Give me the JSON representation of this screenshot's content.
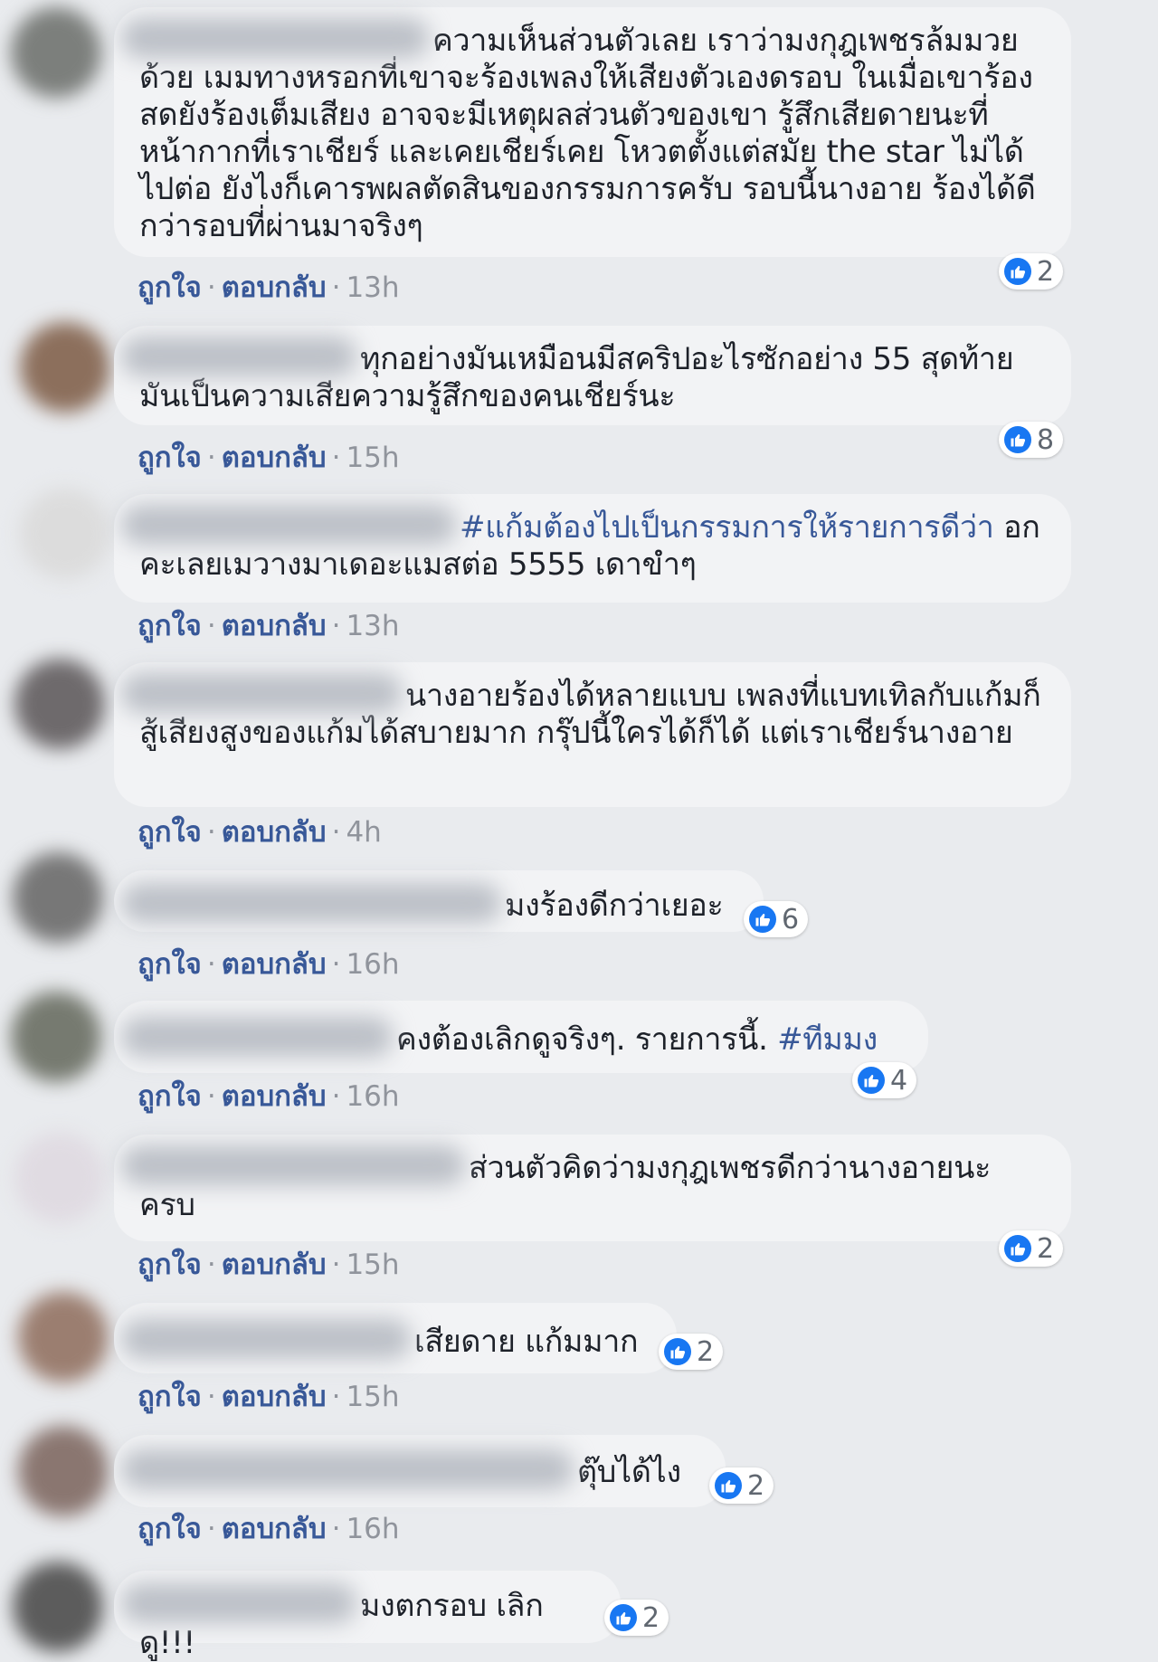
{
  "ui": {
    "like": "ถูกใจ",
    "reply": "ตอบกลับ",
    "dot": "·"
  },
  "comments": [
    {
      "text": "ความเห็นส่วนตัวเลย เราว่ามงกุฎเพชรล้มมวยด้วย เมมทางหรอกที่เขาจะร้องเพลงให้เสียงตัวเองดรอบ ในเมื่อเขาร้องสดยังร้องเต็มเสียง อาจจะมีเหตุผลส่วนตัวของเขา รู้สึกเสียดายนะที่หน้ากากที่เราเชียร์ และเคยเชียร์เคย โหวตตั้งแต่สมัย the star ไม่ได้ไปต่อ ยังไงก็เคารพผลตัดสินของกรรมการครับ รอบนี้นางอาย ร้องได้ดีกว่ารอบที่ผ่านมาจริงๆ",
      "likes": "2",
      "time": "13h"
    },
    {
      "text": "ทุกอย่างมันเหมือนมีสคริปอะไรซักอย่าง 55 สุดท้ายมันเป็นความเสียความรู้สึกของคนเชียร์นะ",
      "likes": "8",
      "time": "15h"
    },
    {
      "hashtag": "#แก้มต้องไปเป็นกรรมการให้รายการดีว่า",
      "text": "อกคะเลยเมวางมาเดอะแมสต่อ 5555 เดาขำๆ",
      "time": "13h"
    },
    {
      "text": "นางอายร้องได้หลายแบบ เพลงที่แบทเทิลกับแก้มก็สู้เสียงสูงของแก้มได้สบายมาก กรุ๊ปนี้ใครได้ก็ได้ แต่เราเชียร์นางอาย",
      "time": "4h"
    },
    {
      "text": "มงร้องดีกว่าเยอะ",
      "likes": "6",
      "time": "16h"
    },
    {
      "text": "คงต้องเลิกดูจริงๆ. รายการนี้. ",
      "hashtag": "#ทีมมง",
      "likes": "4",
      "time": "16h"
    },
    {
      "text": "ส่วนตัวคิดว่ามงกุฎเพชรดีกว่านางอายนะครบ",
      "likes": "2",
      "time": "15h"
    },
    {
      "text": "เสียดาย แก้มมาก",
      "likes": "2",
      "time": "15h"
    },
    {
      "text": "ตุ๊บได้ไง",
      "likes": "2",
      "time": "16h"
    },
    {
      "text": "มงตกรอบ เลิกดู!!!",
      "likes": "2"
    }
  ],
  "colors": {
    "link": "#385898",
    "like": "#1877f2",
    "bubble": "#f2f3f5",
    "page": "#e9ebee"
  }
}
